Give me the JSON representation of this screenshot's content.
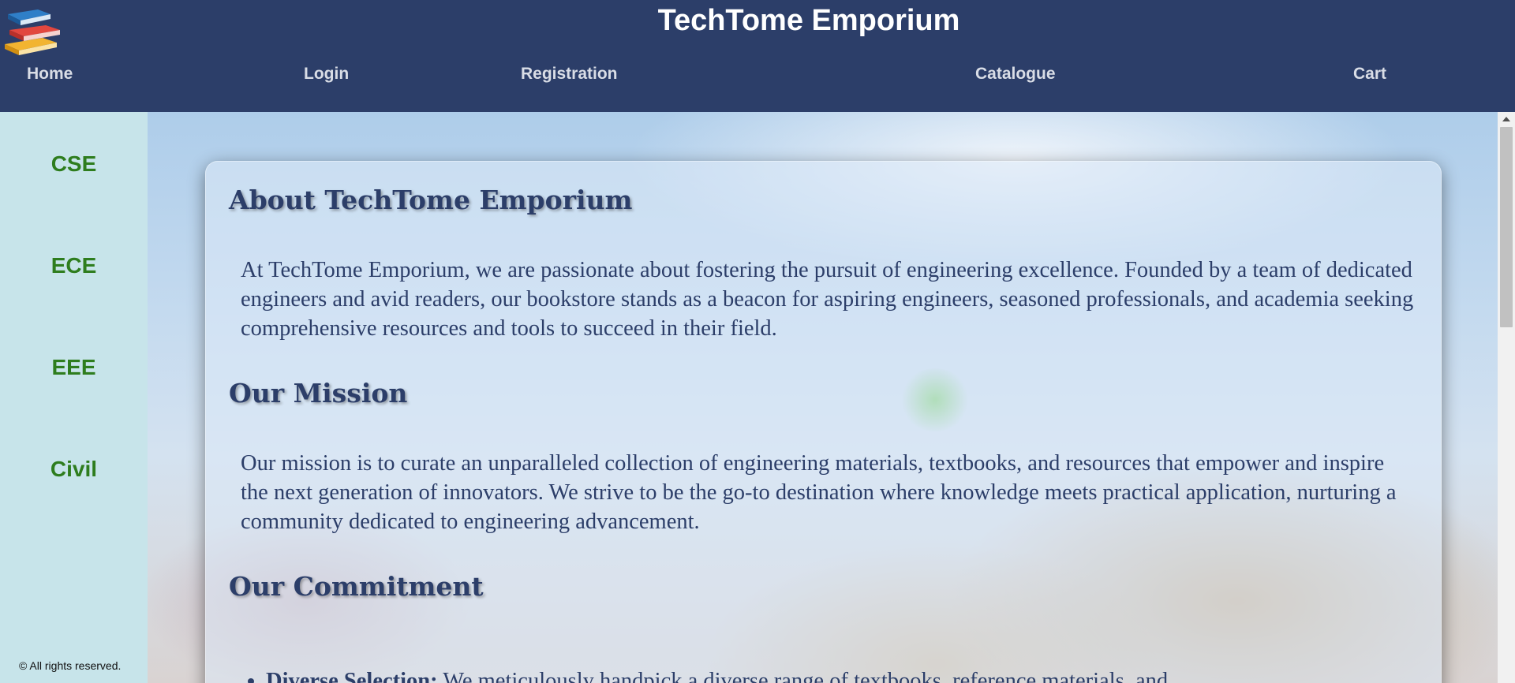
{
  "header": {
    "title": "TechTome Emporium",
    "logo": "stack-of-books-logo"
  },
  "nav": {
    "home": "Home",
    "login": "Login",
    "registration": "Registration",
    "catalogue": "Catalogue",
    "cart": "Cart"
  },
  "sidebar": {
    "items": [
      {
        "label": "CSE"
      },
      {
        "label": "ECE"
      },
      {
        "label": "EEE"
      },
      {
        "label": "Civil"
      }
    ],
    "copyright": "© All rights reserved."
  },
  "content": {
    "about_heading": "About TechTome Emporium",
    "about_text": "At TechTome Emporium, we are passionate about fostering the pursuit of engineering excellence. Founded by a team of dedicated engineers and avid readers, our bookstore stands as a beacon for aspiring engineers, seasoned professionals, and academia seeking comprehensive resources and tools to succeed in their field.",
    "mission_heading": "Our Mission",
    "mission_text": "Our mission is to curate an unparalleled collection of engineering materials, textbooks, and resources that empower and inspire the next generation of innovators. We strive to be the go-to destination where knowledge meets practical application, nurturing a community dedicated to engineering advancement.",
    "commitment_heading": "Our Commitment",
    "commitment_items": [
      {
        "title": "Diverse Selection:",
        "text": " We meticulously handpick a diverse range of textbooks, reference materials, and"
      }
    ]
  },
  "colors": {
    "header_bg": "#2c3e69",
    "sidebar_bg": "#c7e4ea",
    "sidebar_link": "#2e7d1e",
    "heading": "#2c3e69"
  }
}
